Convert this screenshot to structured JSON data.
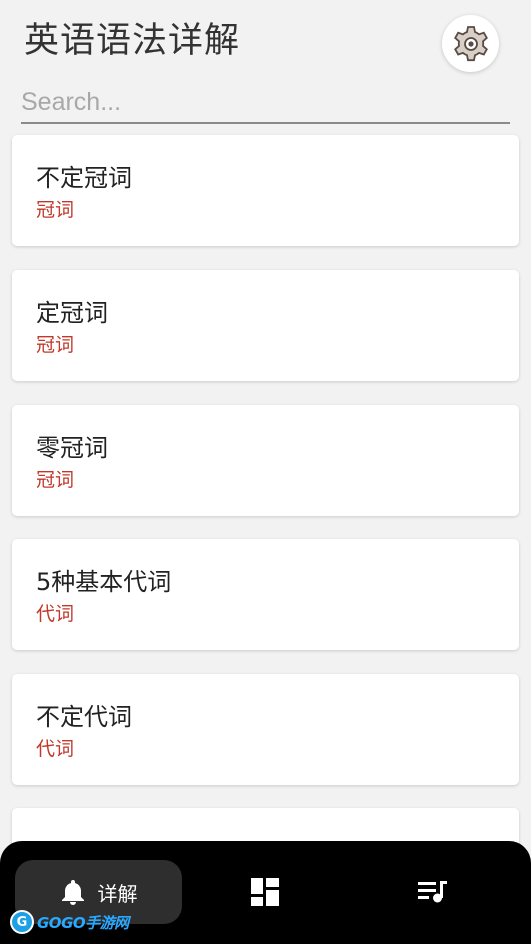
{
  "header": {
    "title": "英语语法详解"
  },
  "search": {
    "placeholder": "Search..."
  },
  "items": [
    {
      "title": "不定冠词",
      "category": "冠词"
    },
    {
      "title": "定冠词",
      "category": "冠词"
    },
    {
      "title": "零冠词",
      "category": "冠词"
    },
    {
      "title": "5种基本代词",
      "category": "代词"
    },
    {
      "title": "不定代词",
      "category": "代词"
    },
    {
      "title": "",
      "category": ""
    }
  ],
  "nav": {
    "active_label": "详解",
    "icons": [
      "bell-icon",
      "dashboard-icon",
      "playlist-icon"
    ]
  },
  "watermark": {
    "logo": "G",
    "text": "GOGO手游网"
  },
  "colors": {
    "accent_red": "#c0392b",
    "nav_bg": "#000000",
    "background": "#f2f2f2"
  }
}
